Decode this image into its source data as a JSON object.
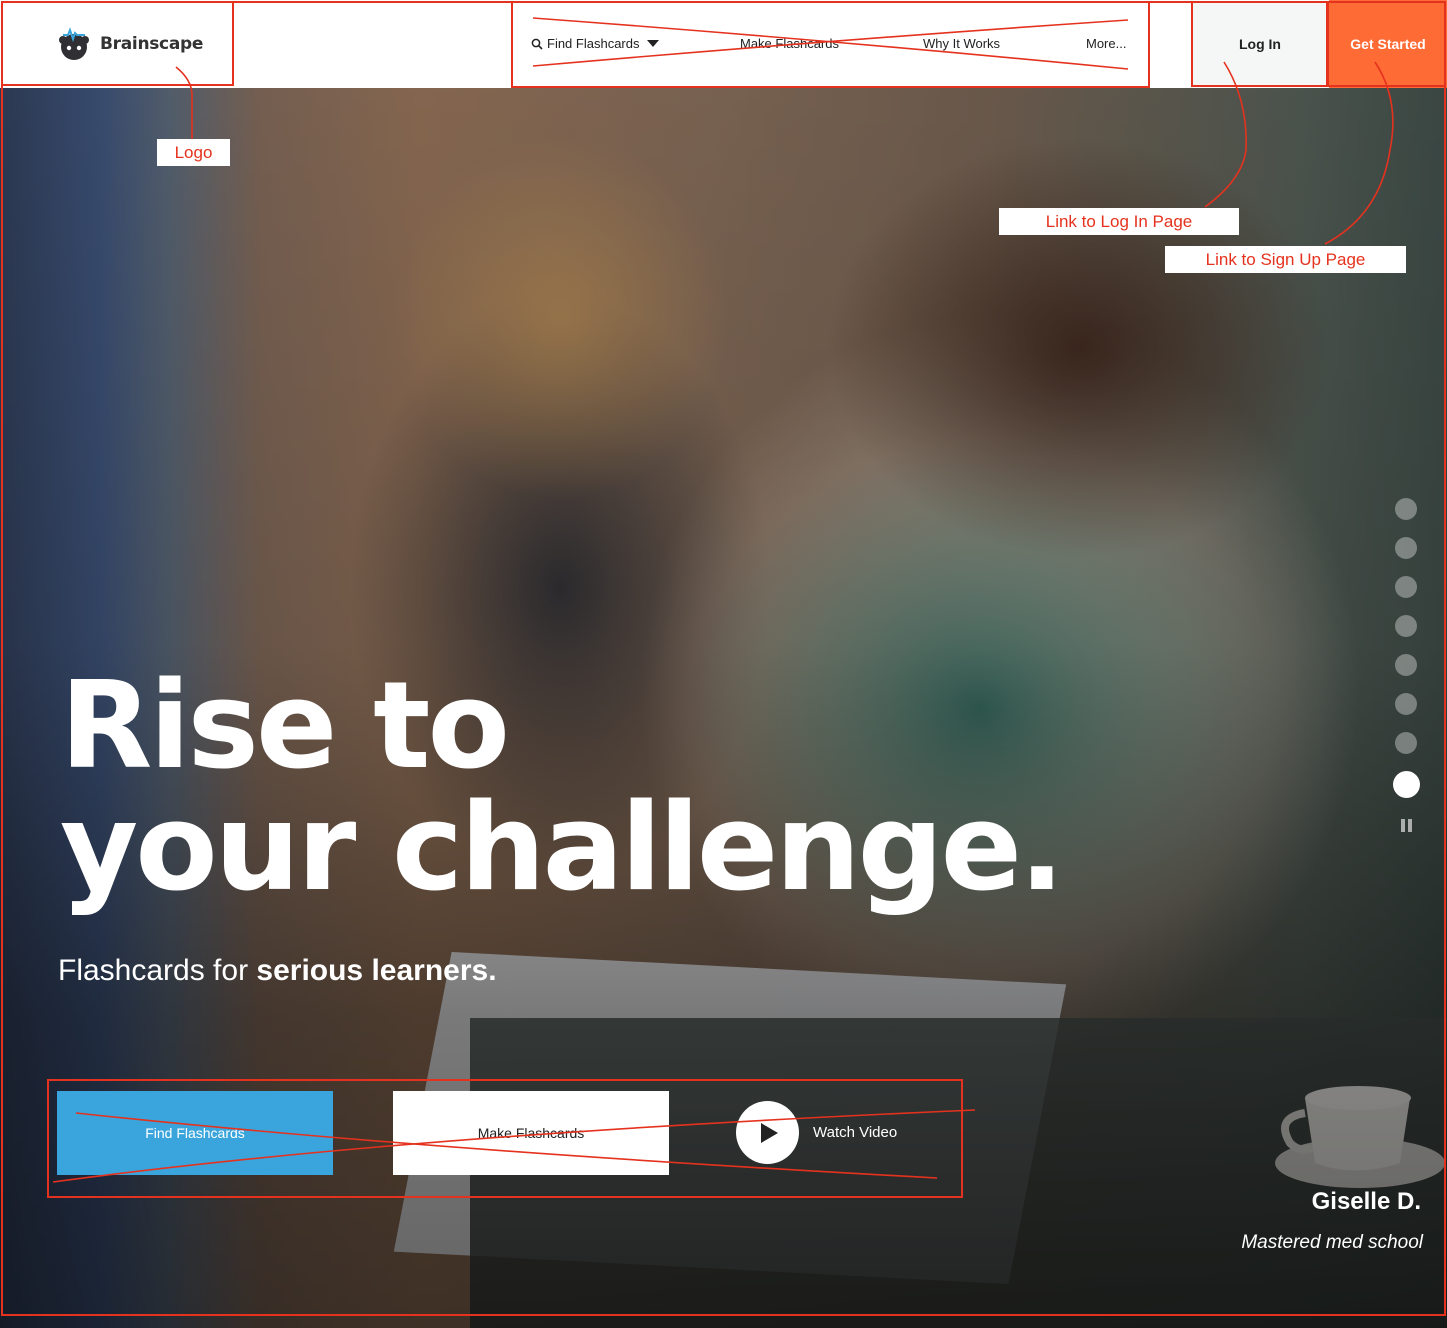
{
  "header": {
    "logo_text": "Brainscape",
    "nav": {
      "find_flashcards": "Find Flashcards",
      "make_flashcards": "Make Flashcards",
      "why_it_works": "Why It Works",
      "more": "More..."
    },
    "login_label": "Log In",
    "get_started_label": "Get Started"
  },
  "hero": {
    "headline_line1": "Rise to",
    "headline_line2": "your challenge.",
    "subline_plain": "Flashcards for ",
    "subline_bold": "serious learners.",
    "cta_find": "Find Flashcards",
    "cta_make": "Make Flashcards",
    "watch_video": "Watch Video",
    "slides_total": 8,
    "active_slide": 8,
    "persona_name": "Giselle D.",
    "persona_desc": "Mastered med school"
  },
  "annotations": {
    "logo": "Logo",
    "login_link": "Link to Log In Page",
    "signup_link": "Link to Sign Up Page"
  },
  "colors": {
    "brand_orange": "#ff6b35",
    "cta_blue": "#3aa5dc",
    "annotation_red": "#e5321e"
  }
}
